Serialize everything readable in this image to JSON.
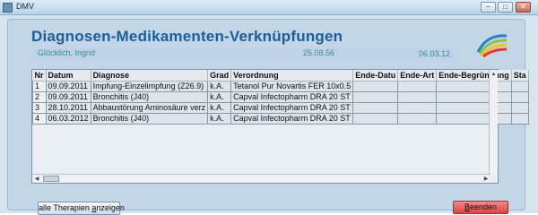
{
  "window": {
    "title": "DMV",
    "buttons": [
      "–",
      "□",
      "✕"
    ]
  },
  "heading": "Diagnosen-Medikamenten-Verknüpfungen",
  "patient": {
    "name": "Glücklich, Ingrid",
    "birth_date": "25.08.56",
    "date": "06.03.12"
  },
  "table": {
    "columns": [
      "Nr",
      "Datum",
      "Diagnose",
      "Grad",
      "Verordnung",
      "Ende-Datu",
      "Ende-Art",
      "Ende-Begründung",
      "Sta"
    ],
    "rows": [
      [
        "1",
        "09.09.2011",
        "Impfung-Einzelimpfung (Z26.9)",
        "k.A.",
        "Tetanol Pur Novartis FER 10x0.5",
        "",
        "",
        "",
        ""
      ],
      [
        "2",
        "09.09.2011",
        "Bronchitis (J40)",
        "k.A.",
        "Capval Infectopharm DRA 20 ST",
        "",
        "",
        "",
        ""
      ],
      [
        "3",
        "28.10.2011",
        "Abbaustörung Aminosäure verz",
        "k.A.",
        "Capval Infectopharm DRA 20 ST",
        "",
        "",
        "",
        ""
      ],
      [
        "4",
        "06.03.2012",
        "Bronchitis (J40)",
        "k.A.",
        "Capval Infectopharm DRA 20 ST",
        "",
        "",
        "",
        ""
      ]
    ]
  },
  "buttons": {
    "show_all": {
      "pre": "alle Therapien ",
      "accel": "a",
      "post": "nzeigen"
    },
    "close": {
      "pre": "",
      "accel": "B",
      "post": "eenden"
    }
  },
  "icons": {
    "app": "app-icon",
    "logo": "swoosh-logo"
  },
  "colors": {
    "heading": "#1b5e98",
    "patient_text": "#3a8f8a",
    "close_button": "#d84444"
  }
}
